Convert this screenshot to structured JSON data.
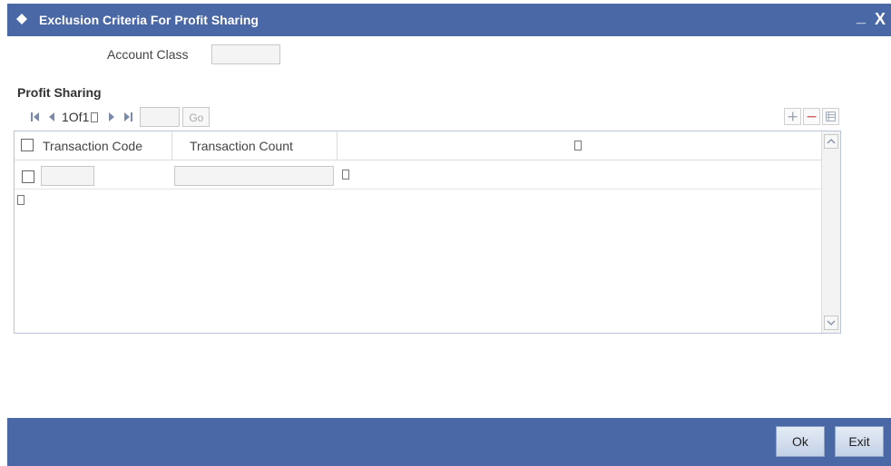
{
  "window": {
    "title": "Exclusion Criteria For Profit Sharing",
    "minimize": "_",
    "close": "X"
  },
  "form": {
    "account_class_label": "Account Class",
    "account_class_value": ""
  },
  "section": {
    "title": "Profit Sharing"
  },
  "pager": {
    "page_text": "1Of1",
    "go_label": "Go",
    "page_input": ""
  },
  "grid": {
    "columns": [
      "Transaction Code",
      "Transaction Count"
    ],
    "rows": [
      {
        "transaction_code": "",
        "transaction_count": ""
      }
    ]
  },
  "footer": {
    "ok_label": "Ok",
    "exit_label": "Exit"
  },
  "colors": {
    "accent": "#4a67a6"
  }
}
